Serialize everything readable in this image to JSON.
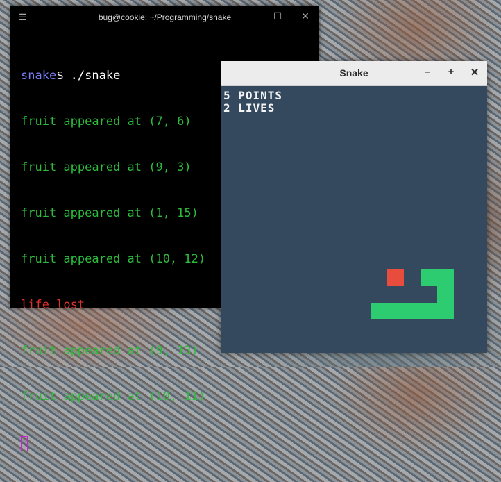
{
  "terminal": {
    "title": "bug@cookie: ~/Programming/snake",
    "menu_icon": "hamburger-icon",
    "prompt_dir": "snake",
    "prompt_cmd": "$ ./snake",
    "lines": [
      {
        "text": "fruit appeared at (7, 6)",
        "color": "#2dbb3c"
      },
      {
        "text": "fruit appeared at (9, 3)",
        "color": "#2dbb3c"
      },
      {
        "text": "fruit appeared at (1, 15)",
        "color": "#2dbb3c"
      },
      {
        "text": "fruit appeared at (10, 12)",
        "color": "#2dbb3c"
      },
      {
        "text": "life lost",
        "color": "#e0302c"
      },
      {
        "text": "fruit appeared at (9, 13)",
        "color": "#2dbb3c"
      },
      {
        "text": "fruit appeared at (10, 11)",
        "color": "#2dbb3c"
      }
    ],
    "controls": {
      "minimize": "–",
      "maximize": "☐",
      "close": "✕"
    }
  },
  "snake_window": {
    "title": "Snake",
    "controls": {
      "minimize": "–",
      "maximize": "+",
      "close": "✕"
    },
    "hud": {
      "points": "5 POINTS",
      "lives": "2 LIVES"
    },
    "colors": {
      "background": "#34495e",
      "snake": "#2ecc71",
      "fruit": "#e74c3c"
    }
  }
}
